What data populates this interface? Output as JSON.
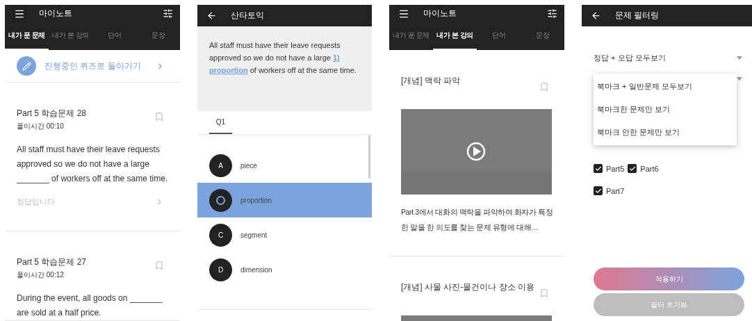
{
  "screens": [
    {
      "kind": "notes",
      "title": "마이노트",
      "tabs": [
        {
          "label": "내가 푼 문제",
          "selected": true
        },
        {
          "label": "내가 본 강의",
          "selected": false
        },
        {
          "label": "단어",
          "selected": false
        },
        {
          "label": "문장",
          "selected": false
        }
      ],
      "resume_link": "진행중인 퀴즈로 돌아가기",
      "items": [
        {
          "kind": "question",
          "title": "Part 5 학습문제 28",
          "time": "풀이시간 00:10",
          "bookmarked": false,
          "text": "All staff must have their leave requests approved so we do not have a large _______ of workers off at the same time.",
          "result": "정답입니다"
        },
        {
          "kind": "question",
          "title": "Part 5 학습문제 27",
          "time": "풀이시간 00:12",
          "bookmarked": false,
          "text": "During the event, all goods on _______ are sold at a half price."
        }
      ]
    },
    {
      "kind": "quiz",
      "title": "산타토익",
      "passage_before": "All staff must have their leave requests approved so we do not have a large ",
      "blank": "1) proportion",
      "passage_after": " of workers off at the same time.",
      "tabs": [
        {
          "label": "Q1",
          "selected": true
        }
      ],
      "choices": [
        {
          "letter": "A",
          "text": "piece",
          "selected": false
        },
        {
          "text": "proportion",
          "selected": true
        },
        {
          "letter": "C",
          "text": "segment",
          "selected": false
        },
        {
          "letter": "D",
          "text": "dimension",
          "selected": false
        }
      ]
    },
    {
      "kind": "notes",
      "title": "마이노트",
      "tabs": [
        {
          "label": "내가 푼 문제",
          "selected": false
        },
        {
          "label": "내가 본 강의",
          "selected": true
        },
        {
          "label": "단어",
          "selected": false
        },
        {
          "label": "문장",
          "selected": false
        }
      ],
      "items": [
        {
          "kind": "lecture",
          "title": "[개념] 맥락 파악",
          "bookmarked": false,
          "text": "Part 3에서 대화의 맥락을 파악하여 화자가 특정한 말을 한 의도를 찾는 문제 유형에 대해…"
        },
        {
          "kind": "lecture",
          "title": "[개념] 사물 사진-물건이나 장소 이용",
          "bookmarked": false
        }
      ]
    },
    {
      "kind": "filter",
      "title": "문제 필터링",
      "selects": [
        {
          "value": "정답 + 오답 모두보기"
        }
      ],
      "menu": [
        "북마크 + 일반문제 모두보기",
        "북마크한 문제만 보기",
        "북마크 안한 문제만 보기"
      ],
      "checkbox_rows": [
        [
          {
            "label": "Part5",
            "checked": true
          },
          {
            "label": "Part6",
            "checked": true
          }
        ],
        [
          {
            "label": "Part7",
            "checked": true
          }
        ]
      ],
      "buttons": [
        {
          "kind": "primary",
          "label": "적용하기"
        },
        {
          "kind": "secondary",
          "label": "필터 초기화"
        }
      ]
    }
  ]
}
